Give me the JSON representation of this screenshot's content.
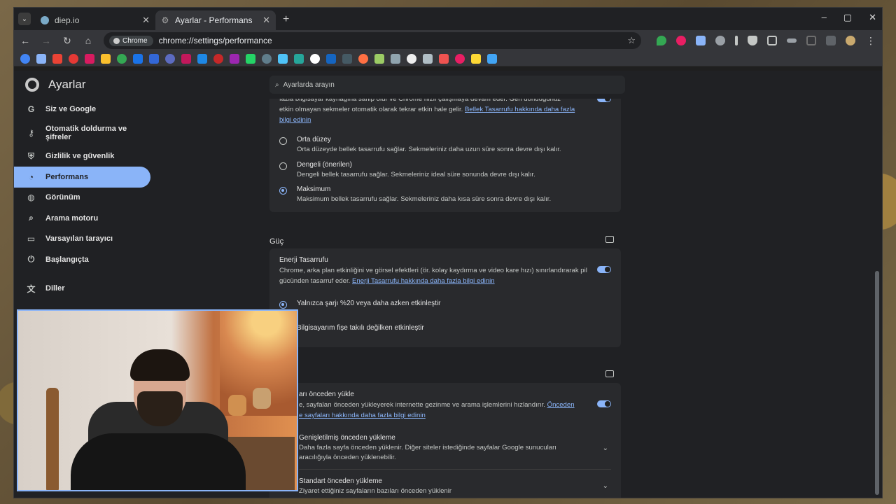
{
  "tabs": [
    {
      "title": "diep.io",
      "active": false
    },
    {
      "title": "Ayarlar - Performans",
      "active": true
    }
  ],
  "window_controls": {
    "minimize": "–",
    "maximize": "▢",
    "close": "✕"
  },
  "toolbar": {
    "chip_label": "Chrome",
    "url": "chrome://settings/performance"
  },
  "bookmark_colors": [
    "#4285f4",
    "#8ab4f8",
    "#ea4335",
    "#e53935",
    "#d81b60",
    "#fbc02d",
    "#34a853",
    "#1a73e8",
    "#3367d6",
    "#5c6bc0",
    "#c2185b",
    "#1e88e5",
    "#c62828",
    "#9c27b0",
    "#25d366",
    "#607d8b",
    "#4fc3f7",
    "#26a69a",
    "#ffffff",
    "#1565c0",
    "#455a64",
    "#ff7043",
    "#9ccc65",
    "#90a4ae",
    "#eeeeee",
    "#b0bec5",
    "#ef5350",
    "#e91e63",
    "#fdd835",
    "#42a5f5"
  ],
  "settings": {
    "app_title": "Ayarlar",
    "search_placeholder": "Ayarlarda arayın",
    "sidebar": [
      {
        "label": "Siz ve Google",
        "icon": "google-icon",
        "glyph": "G"
      },
      {
        "label": "Otomatik doldurma ve şifreler",
        "icon": "key-icon",
        "glyph": "⚷"
      },
      {
        "label": "Gizlilik ve güvenlik",
        "icon": "shield-icon",
        "glyph": "⛨"
      },
      {
        "label": "Performans",
        "icon": "speedometer-icon",
        "glyph": "◔",
        "active": true
      },
      {
        "label": "Görünüm",
        "icon": "palette-icon",
        "glyph": "◍"
      },
      {
        "label": "Arama motoru",
        "icon": "search-icon",
        "glyph": "⌕"
      },
      {
        "label": "Varsayılan tarayıcı",
        "icon": "browser-icon",
        "glyph": "▭"
      },
      {
        "label": "Başlangıçta",
        "icon": "power-icon",
        "glyph": "⏻"
      },
      {
        "label": "Diller",
        "icon": "translate-icon",
        "glyph": "文"
      }
    ],
    "memory": {
      "intro_text": "fazla bilgisayar kaynağına sahip olur ve Chrome hızlı çalışmaya devam eder. Geri döndüğünüz etkin olmayan sekmeler otomatik olarak tekrar etkin hale gelir.",
      "intro_link": "Bellek Tasarrufu hakkında daha fazla bilgi edinin",
      "options": [
        {
          "title": "Orta düzey",
          "desc": "Orta düzeyde bellek tasarrufu sağlar. Sekmeleriniz daha uzun süre sonra devre dışı kalır.",
          "selected": false
        },
        {
          "title": "Dengeli (önerilen)",
          "desc": "Dengeli bellek tasarrufu sağlar. Sekmeleriniz ideal süre sonunda devre dışı kalır.",
          "selected": false
        },
        {
          "title": "Maksimum",
          "desc": "Maksimum bellek tasarrufu sağlar. Sekmeleriniz daha kısa süre sonra devre dışı kalır.",
          "selected": true
        }
      ]
    },
    "power": {
      "section_title": "Güç",
      "title": "Enerji Tasarrufu",
      "desc": "Chrome, arka plan etkinliğini ve görsel efektleri (ör. kolay kaydırma ve video kare hızı) sınırlandırarak pil gücünden tasarruf eder.",
      "link": "Enerji Tasarrufu hakkında daha fazla bilgi edinin",
      "options": [
        {
          "title": "Yalnızca şarjı %20 veya daha azken etkinleştir",
          "selected": true
        },
        {
          "title": "Bilgisayarım fişe takılı değilken etkinleştir",
          "selected": false
        }
      ]
    },
    "preload": {
      "title": "arı önceden yükle",
      "desc": "e, sayfaları önceden yükleyerek internette gezinme ve arama işlemlerini hızlandırır.",
      "link_part1": "Önceden",
      "link_part2": "e sayfaları hakkında daha fazla bilgi edinin",
      "extended_title": "Genişletilmiş önceden yükleme",
      "extended_desc1": "Daha fazla sayfa önceden yüklenir. Diğer siteler istediğinde sayfalar Google sunucuları",
      "extended_desc2": "aracılığıyla önceden yüklenebilir.",
      "standard_title": "Standart önceden yükleme",
      "standard_desc": "Ziyaret ettiğiniz sayfaların bazıları önceden yüklenir"
    }
  }
}
